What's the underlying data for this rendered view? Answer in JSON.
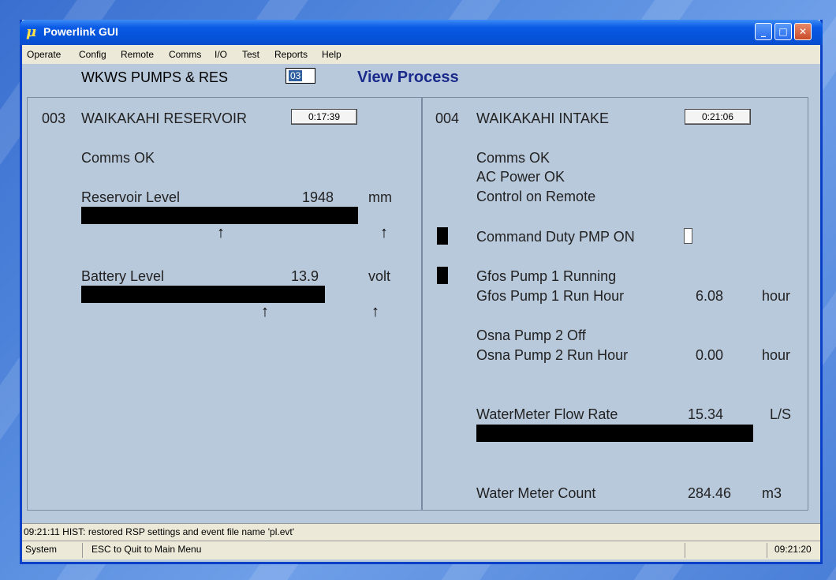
{
  "window": {
    "title": "Powerlink GUI",
    "app_icon_glyph": "μ"
  },
  "menu": [
    "Operate",
    "Config",
    "Remote",
    "Comms",
    "I/O",
    "Test",
    "Reports",
    "Help"
  ],
  "header": {
    "group": "WKWS PUMPS & RES",
    "site_value": "03",
    "view_title": "View Process"
  },
  "left": {
    "id": "003",
    "name": "WAIKAKAHI RESERVOIR",
    "timer": "0:17:39",
    "comms": "Comms OK",
    "reservoir": {
      "label": "Reservoir Level",
      "value": "1948",
      "unit": "mm",
      "fill": 0.72
    },
    "battery": {
      "label": "Battery Level",
      "value": "13.9",
      "unit": "volt",
      "fill": 0.85
    }
  },
  "right": {
    "id": "004",
    "name": "WAIKAKAHI INTAKE",
    "timer": "0:21:06",
    "status": [
      "Comms  OK",
      "AC Power OK",
      "Control on Remote"
    ],
    "command": "Command Duty PMP ON",
    "pump1": {
      "status": "Gfos Pump 1 Running",
      "hour_label": "Gfos Pump 1 Run Hour",
      "hour_value": "6.08",
      "unit": "hour"
    },
    "pump2": {
      "status": "Osna Pump 2 Off",
      "hour_label": "Osna Pump 2 Run Hour",
      "hour_value": "0.00",
      "unit": "hour"
    },
    "flow": {
      "label": "WaterMeter Flow Rate",
      "value": "15.34",
      "unit": "L/S"
    },
    "count": {
      "label": "Water Meter Count",
      "value": "284.46",
      "unit": "m3"
    }
  },
  "event_line": "09:21:11  HIST: restored RSP settings and event file name 'pl.evt'",
  "statusbar": {
    "left": "System",
    "message": "ESC to Quit to Main Menu",
    "time": "09:21:20"
  },
  "colors": {
    "titlebar": "#0453d8",
    "content_bg": "#b9c9dc",
    "view_title": "#1a2a8a"
  }
}
